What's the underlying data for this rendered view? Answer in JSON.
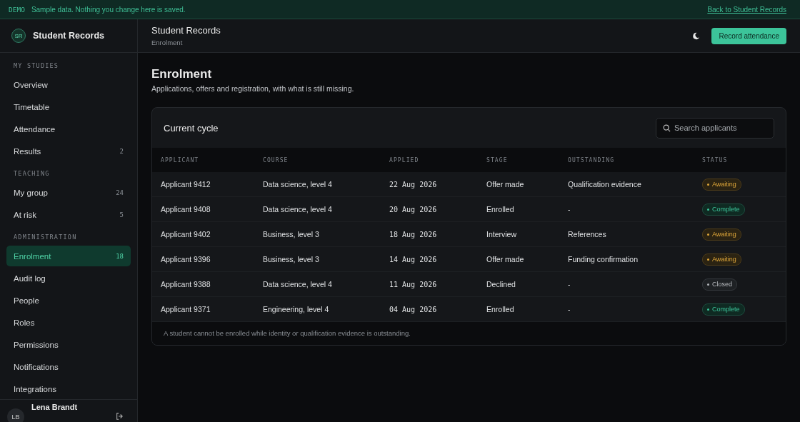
{
  "banner": {
    "tag": "DEMO",
    "message": "Sample data. Nothing you change here is saved.",
    "link": "Back to Student Records"
  },
  "brand": {
    "initials": "SR",
    "name": "Student Records"
  },
  "sidebar": {
    "sections": [
      {
        "heading": "MY STUDIES",
        "items": [
          {
            "label": "Overview",
            "selected": false
          },
          {
            "label": "Timetable",
            "selected": false
          },
          {
            "label": "Attendance",
            "selected": false
          },
          {
            "label": "Results",
            "count": "2",
            "selected": false
          }
        ]
      },
      {
        "heading": "TEACHING",
        "items": [
          {
            "label": "My group",
            "count": "24",
            "selected": false
          },
          {
            "label": "At risk",
            "count": "5",
            "selected": false
          }
        ]
      },
      {
        "heading": "ADMINISTRATION",
        "items": [
          {
            "label": "Enrolment",
            "count": "18",
            "selected": true
          },
          {
            "label": "Audit log",
            "selected": false
          },
          {
            "label": "People",
            "selected": false
          },
          {
            "label": "Roles",
            "selected": false
          },
          {
            "label": "Permissions",
            "selected": false
          },
          {
            "label": "Notifications",
            "selected": false
          },
          {
            "label": "Integrations",
            "selected": false
          }
        ]
      }
    ],
    "user": {
      "initials": "LB",
      "name": "Lena Brandt"
    }
  },
  "header": {
    "title": "Student Records",
    "subtitle": "Enrolment",
    "action": "Record attendance"
  },
  "page": {
    "title": "Enrolment",
    "description": "Applications, offers and registration, with what is still missing."
  },
  "card": {
    "title": "Current cycle",
    "search": {
      "placeholder": "Search applicants"
    },
    "table": {
      "columns": [
        "APPLICANT",
        "COURSE",
        "APPLIED",
        "STAGE",
        "OUTSTANDING",
        "STATUS"
      ],
      "rows": [
        {
          "applicant": "Applicant 9412",
          "course": "Data science, level 4",
          "applied": "22 Aug 2026",
          "stage": "Offer made",
          "outstanding": "Qualification evidence",
          "status": {
            "label": "Awaiting",
            "kind": "awaiting"
          }
        },
        {
          "applicant": "Applicant 9408",
          "course": "Data science, level 4",
          "applied": "20 Aug 2026",
          "stage": "Enrolled",
          "outstanding": "-",
          "status": {
            "label": "Complete",
            "kind": "complete"
          }
        },
        {
          "applicant": "Applicant 9402",
          "course": "Business, level 3",
          "applied": "18 Aug 2026",
          "stage": "Interview",
          "outstanding": "References",
          "status": {
            "label": "Awaiting",
            "kind": "awaiting"
          }
        },
        {
          "applicant": "Applicant 9396",
          "course": "Business, level 3",
          "applied": "14 Aug 2026",
          "stage": "Offer made",
          "outstanding": "Funding confirmation",
          "status": {
            "label": "Awaiting",
            "kind": "awaiting"
          }
        },
        {
          "applicant": "Applicant 9388",
          "course": "Data science, level 4",
          "applied": "11 Aug 2026",
          "stage": "Declined",
          "outstanding": "-",
          "status": {
            "label": "Closed",
            "kind": "closed"
          }
        },
        {
          "applicant": "Applicant 9371",
          "course": "Engineering, level 4",
          "applied": "04 Aug 2026",
          "stage": "Enrolled",
          "outstanding": "-",
          "status": {
            "label": "Complete",
            "kind": "complete"
          }
        }
      ]
    },
    "footnote": "A student cannot be enrolled while identity or qualification evidence is outstanding."
  }
}
